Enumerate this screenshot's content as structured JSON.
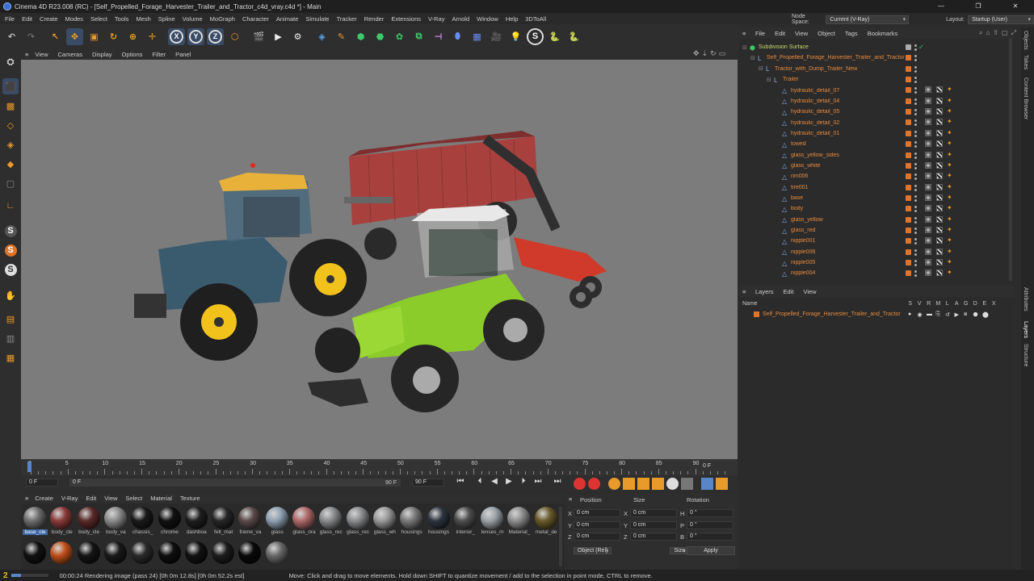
{
  "window": {
    "title": "Cinema 4D R23.008 (RC) - [Self_Propelled_Forage_Harvester_Trailer_and_Tractor_c4d_vray.c4d *] - Main",
    "controls": [
      "—",
      "❐",
      "✕"
    ]
  },
  "menubar": {
    "items": [
      "File",
      "Edit",
      "Create",
      "Modes",
      "Select",
      "Tools",
      "Mesh",
      "Spline",
      "Volume",
      "MoGraph",
      "Character",
      "Animate",
      "Simulate",
      "Tracker",
      "Render",
      "Extensions",
      "V-Ray",
      "Arnold",
      "Window",
      "Help",
      "3DToAll"
    ],
    "node_space_label": "Node Space:",
    "node_space_value": "Current (V-Ray)",
    "layout_label": "Layout:",
    "layout_value": "Startup (User)"
  },
  "toolbar": {
    "axis_x": "X",
    "axis_y": "Y",
    "axis_z": "Z"
  },
  "viewport": {
    "menu": [
      "View",
      "Cameras",
      "Display",
      "Options",
      "Filter",
      "Panel"
    ]
  },
  "timeline": {
    "ticks": [
      "0",
      "5",
      "10",
      "15",
      "20",
      "25",
      "30",
      "35",
      "40",
      "45",
      "50",
      "55",
      "60",
      "65",
      "70",
      "75",
      "80",
      "85",
      "90"
    ],
    "current_frame": "0 F",
    "start_field": "0 F",
    "start_field2": "0 F",
    "end_field": "90 F",
    "end_field2": "90 F"
  },
  "materials": {
    "menu": [
      "Create",
      "V-Ray",
      "Edit",
      "View",
      "Select",
      "Material",
      "Texture"
    ],
    "row1": [
      {
        "label": "base_cle",
        "color": "#6e6e6e",
        "selected": true
      },
      {
        "label": "body_cle",
        "color": "#8a3a3a"
      },
      {
        "label": "body_cle",
        "color": "#5a2a2a"
      },
      {
        "label": "body_va",
        "color": "#8b8b8b"
      },
      {
        "label": "chassis_",
        "color": "#1a1a1a"
      },
      {
        "label": "chrome",
        "color": "#111111"
      },
      {
        "label": "dashboa",
        "color": "#1e1e1e"
      },
      {
        "label": "felt_mat",
        "color": "#262626"
      },
      {
        "label": "frame_va",
        "color": "#5a4a4a"
      },
      {
        "label": "glass",
        "color": "#8fa0b0"
      },
      {
        "label": "glass_ora",
        "color": "#b06a6a"
      },
      {
        "label": "glass_rec",
        "color": "#888a8c"
      },
      {
        "label": "glass_rec",
        "color": "#8a8c8e"
      },
      {
        "label": "glass_wh",
        "color": "#9a9a9a"
      },
      {
        "label": "housings",
        "color": "#7a7a7a"
      },
      {
        "label": "housings",
        "color": "#2e3540"
      },
      {
        "label": "interior_",
        "color": "#4e4e4e"
      },
      {
        "label": "lenses_m",
        "color": "#9aa2a8"
      },
      {
        "label": "Material_",
        "color": "#8e8e8e"
      },
      {
        "label": "metal_de",
        "color": "#6a5a2a"
      }
    ],
    "row2": [
      {
        "label": "",
        "color": "#111111"
      },
      {
        "label": "",
        "color": "#c0501a"
      },
      {
        "label": "",
        "color": "#151515"
      },
      {
        "label": "",
        "color": "#1a1a1a"
      },
      {
        "label": "",
        "color": "#2a2a2a"
      },
      {
        "label": "",
        "color": "#0e0e0e"
      },
      {
        "label": "",
        "color": "#121212"
      },
      {
        "label": "",
        "color": "#1c1c1c"
      },
      {
        "label": "",
        "color": "#0a0a0a"
      },
      {
        "label": "",
        "color": "#6a6a6a"
      }
    ]
  },
  "coords": {
    "headers": [
      "Position",
      "Size",
      "Rotation"
    ],
    "rows": [
      {
        "axis": "X",
        "pos": "0 cm",
        "size_axis": "X",
        "size": "0 cm",
        "rot_axis": "H",
        "rot": "0 °"
      },
      {
        "axis": "Y",
        "pos": "0 cm",
        "size_axis": "Y",
        "size": "0 cm",
        "rot_axis": "P",
        "rot": "0 °"
      },
      {
        "axis": "Z",
        "pos": "0 cm",
        "size_axis": "Z",
        "size": "0 cm",
        "rot_axis": "B",
        "rot": "0 °"
      }
    ],
    "mode": "Object (Rel)",
    "size_mode": "Size",
    "apply": "Apply"
  },
  "objects": {
    "menu": [
      "File",
      "Edit",
      "View",
      "Object",
      "Tags",
      "Bookmarks"
    ],
    "rows": [
      {
        "name": "Subdivision Surface",
        "indent": 0,
        "green": true,
        "tags": false
      },
      {
        "name": "Self_Propelled_Forage_Harvester_Trailer_and_Tractor",
        "indent": 1,
        "green": false,
        "tags": false
      },
      {
        "name": "Tractor_with_Dump_Trailer_New",
        "indent": 2,
        "green": false,
        "tags": false
      },
      {
        "name": "Trailer",
        "indent": 3,
        "green": false,
        "tags": false
      },
      {
        "name": "hydraulic_detail_07",
        "indent": 4,
        "green": false,
        "tags": true
      },
      {
        "name": "hydraulic_detail_04",
        "indent": 4,
        "green": false,
        "tags": true
      },
      {
        "name": "hydraulic_detail_05",
        "indent": 4,
        "green": false,
        "tags": true
      },
      {
        "name": "hydraulic_detail_02",
        "indent": 4,
        "green": false,
        "tags": true
      },
      {
        "name": "hydraulic_detail_01",
        "indent": 4,
        "green": false,
        "tags": true
      },
      {
        "name": "towed",
        "indent": 4,
        "green": false,
        "tags": true
      },
      {
        "name": "glass_yellow_sides",
        "indent": 4,
        "green": false,
        "tags": true
      },
      {
        "name": "glass_white",
        "indent": 4,
        "green": false,
        "tags": true
      },
      {
        "name": "rim006",
        "indent": 4,
        "green": false,
        "tags": true
      },
      {
        "name": "tire001",
        "indent": 4,
        "green": false,
        "tags": true
      },
      {
        "name": "base",
        "indent": 4,
        "green": false,
        "tags": true
      },
      {
        "name": "body",
        "indent": 4,
        "green": false,
        "tags": true
      },
      {
        "name": "glass_yellow",
        "indent": 4,
        "green": false,
        "tags": true
      },
      {
        "name": "glass_red",
        "indent": 4,
        "green": false,
        "tags": true
      },
      {
        "name": "nipple001",
        "indent": 4,
        "green": false,
        "tags": true
      },
      {
        "name": "nipple006",
        "indent": 4,
        "green": false,
        "tags": true
      },
      {
        "name": "nipple005",
        "indent": 4,
        "green": false,
        "tags": true
      },
      {
        "name": "nipple004",
        "indent": 4,
        "green": false,
        "tags": true
      }
    ]
  },
  "layers": {
    "menu": [
      "Layers",
      "Edit",
      "View"
    ],
    "name_header": "Name",
    "columns": [
      "S",
      "V",
      "R",
      "M",
      "L",
      "A",
      "G",
      "D",
      "E",
      "X"
    ],
    "rows": [
      {
        "name": "Self_Propelled_Forage_Harvester_Trailer_and_Tractor",
        "color": "#e0742a"
      }
    ]
  },
  "right_tabs": [
    "Objects",
    "Takes",
    "Content Browser",
    "Attributes",
    "Layers",
    "Structure"
  ],
  "status": {
    "render_time": "00:00:24 Rendering image (pass 24) [0h 0m 12.8s] [0h 0m 52.2s est]",
    "hint": "Move: Click and drag to move elements. Hold down SHIFT to quantize movement / add to the selection in point mode, CTRL to remove."
  },
  "colors": {
    "accent_orange": "#e0742a",
    "selection_blue": "#3d6aa6",
    "viewport_bg": "#7c7c7c"
  }
}
